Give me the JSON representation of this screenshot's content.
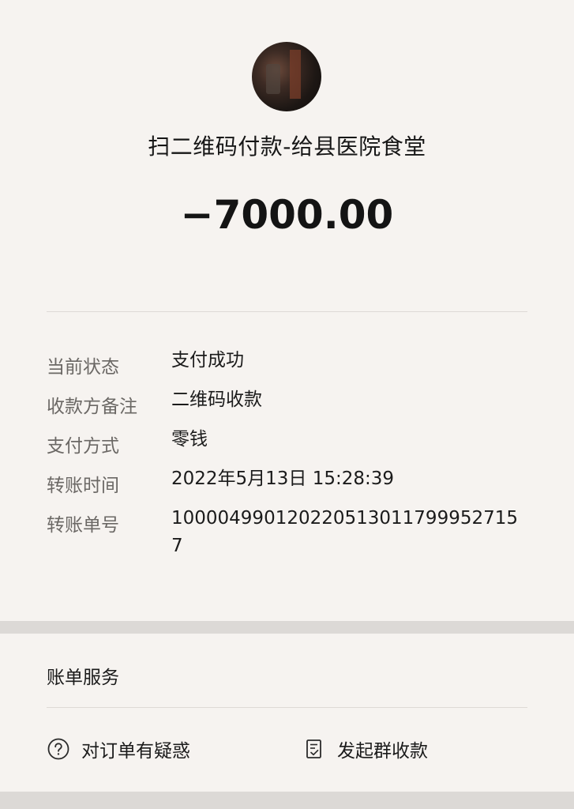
{
  "header": {
    "payee_title": "扫二维码付款-给县医院食堂",
    "amount": "−7000.00"
  },
  "details": [
    {
      "label": "当前状态",
      "value": "支付成功"
    },
    {
      "label": "收款方备注",
      "value": "二维码收款"
    },
    {
      "label": "支付方式",
      "value": "零钱"
    },
    {
      "label": "转账时间",
      "value": "2022年5月13日 15:28:39"
    },
    {
      "label": "转账单号",
      "value": "100004990120220513011799952715 7"
    }
  ],
  "bill_service": {
    "title": "账单服务",
    "actions": [
      {
        "label": "对订单有疑惑",
        "icon": "question-circle-icon"
      },
      {
        "label": "发起群收款",
        "icon": "document-check-icon"
      }
    ]
  },
  "colors": {
    "background": "#f6f3f0",
    "label": "#6b6865",
    "text": "#1b1b1b",
    "separator": "#dcd9d6"
  }
}
